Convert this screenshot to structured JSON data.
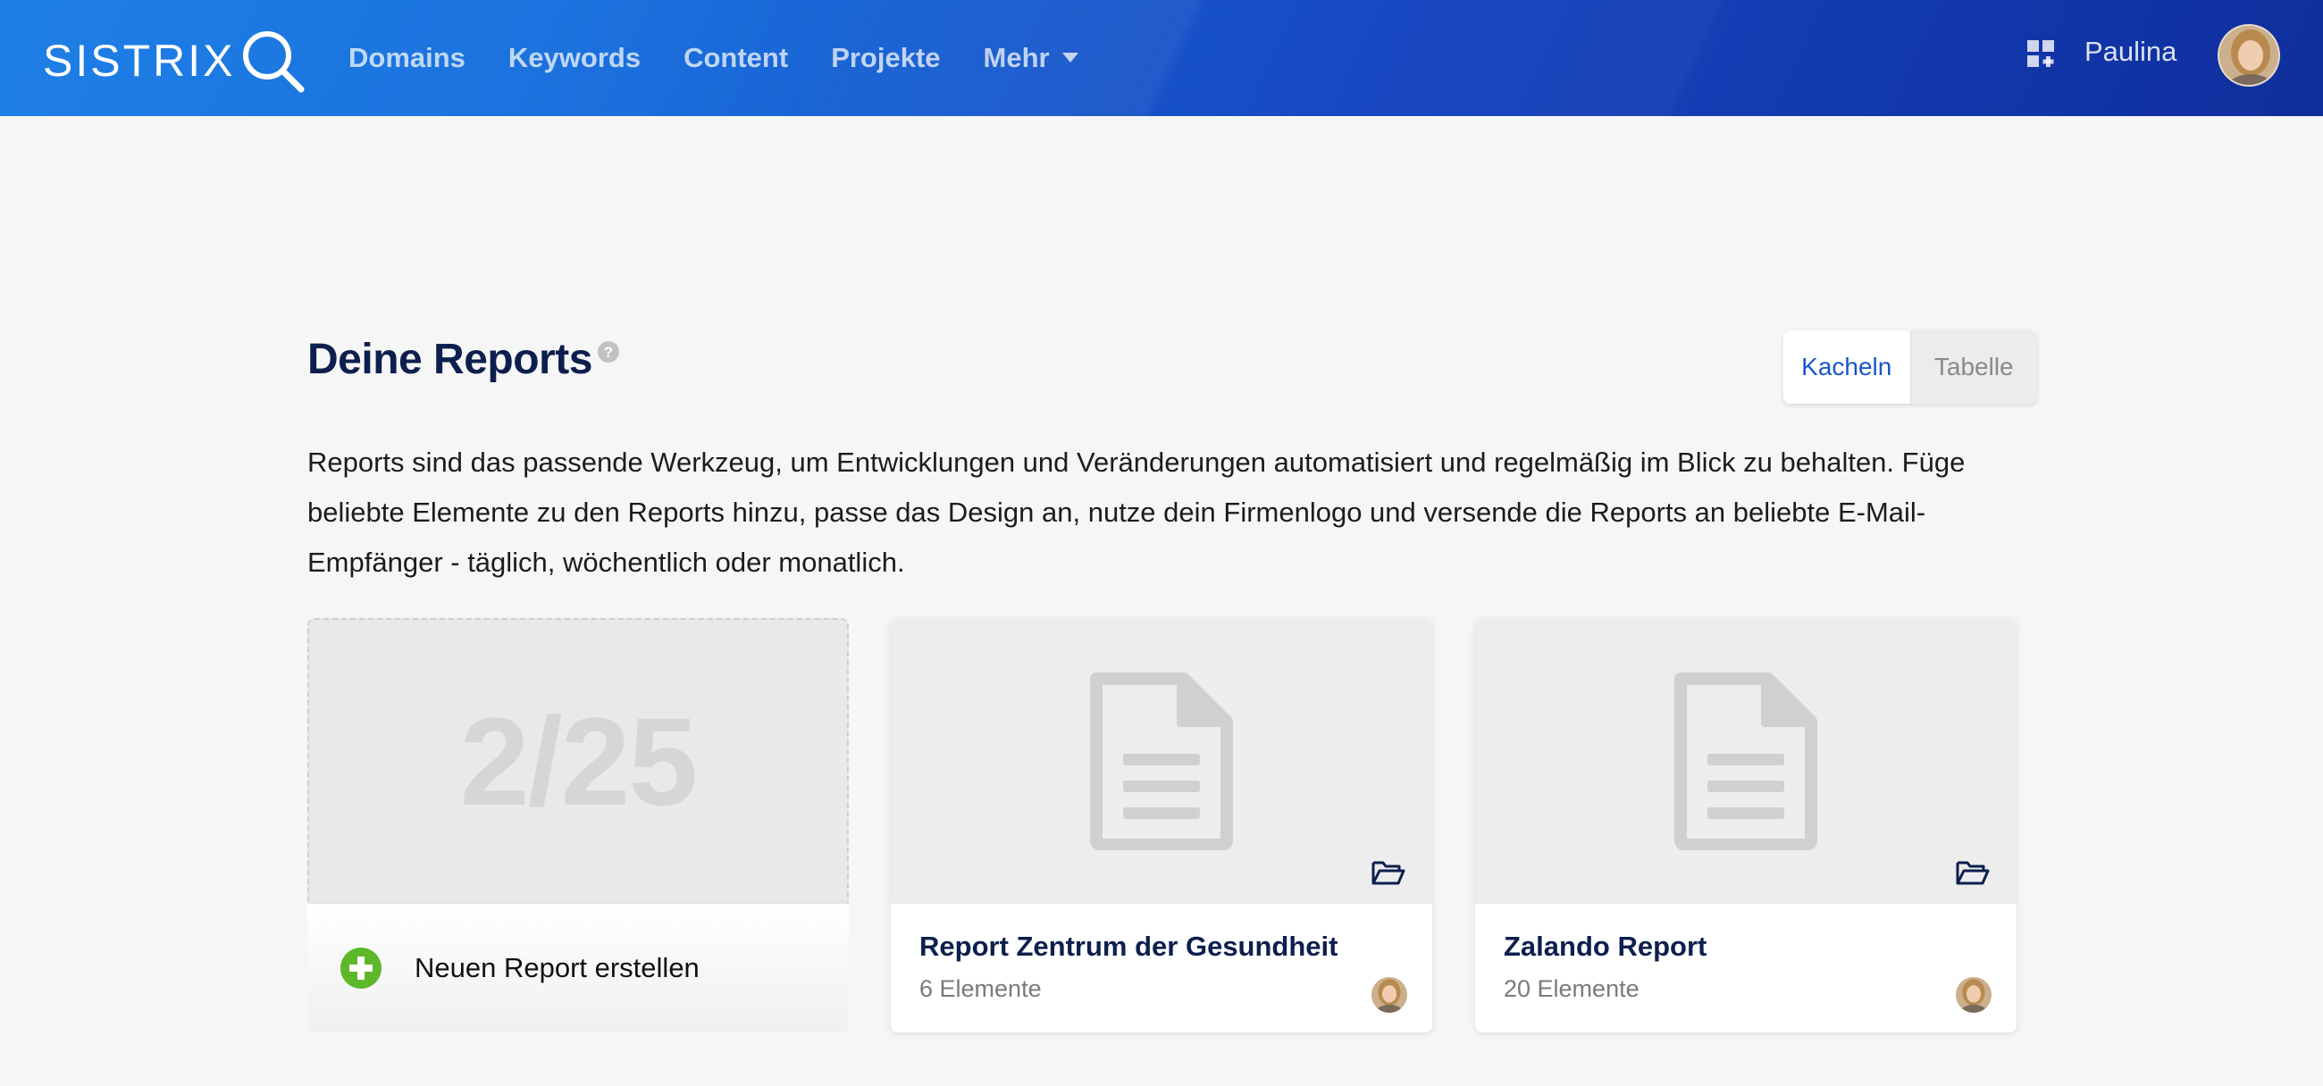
{
  "header": {
    "logo": "SISTRIX",
    "nav": [
      "Domains",
      "Keywords",
      "Content",
      "Projekte",
      "Mehr"
    ],
    "user_name": "Paulina"
  },
  "main": {
    "title": "Deine Reports",
    "view_toggle": {
      "tiles": "Kacheln",
      "table": "Tabelle",
      "active": "Kacheln"
    },
    "intro": "Reports sind das passende Werkzeug, um Entwicklungen und Veränderungen automatisiert und regelmäßig im Blick zu behalten. Füge beliebte Elemente zu den Reports hinzu, passe das Design an, nutze dein Firmenlogo und versende die Reports an beliebte E-Mail-Empfänger - täglich, wöchentlich oder monatlich.",
    "new_report": {
      "counter": "2/25",
      "label": "Neuen Report erstellen"
    },
    "reports": [
      {
        "title": "Report Zentrum der Gesundheit",
        "count": "6 Elemente"
      },
      {
        "title": "Zalando Report",
        "count": "20 Elemente"
      }
    ]
  },
  "colors": {
    "header_start": "#1e80e6",
    "header_end": "#0f2e9c",
    "title": "#0d1f4e",
    "accent_blue": "#1a56c9",
    "add_green": "#5cb829"
  },
  "icons": [
    "search-logo-icon",
    "chevron-down-icon",
    "apps-grid-icon",
    "help-icon",
    "plus-circle-icon",
    "document-icon",
    "folder-open-icon",
    "avatar"
  ]
}
